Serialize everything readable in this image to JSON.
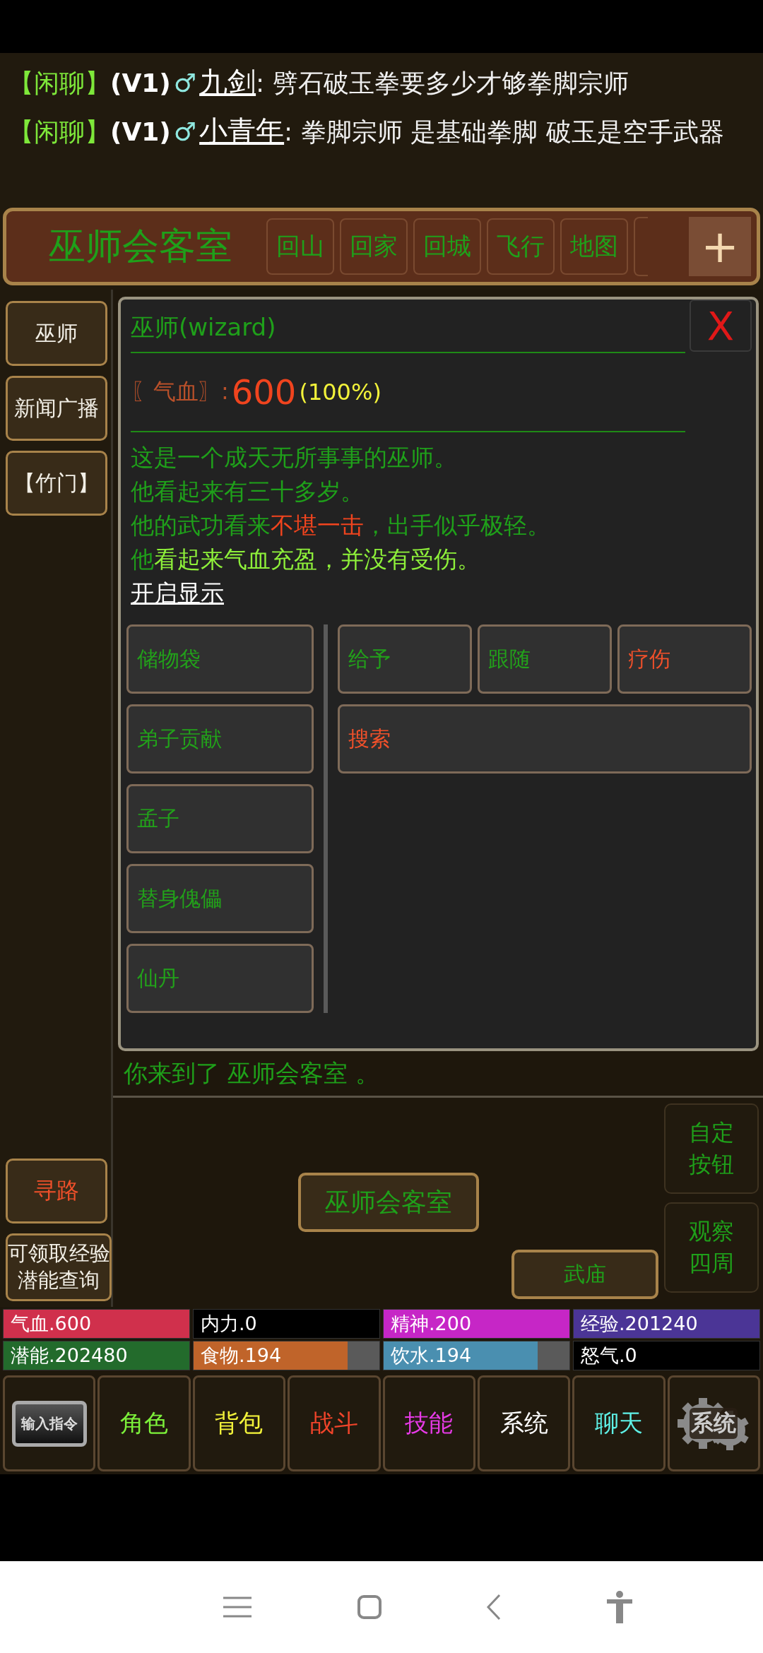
{
  "chat": [
    {
      "channel": "【闲聊】",
      "vip": "(V1)",
      "gender": "♂",
      "name": "九剑",
      "message": ": 劈石破玉拳要多少才够拳脚宗师"
    },
    {
      "channel": "【闲聊】",
      "vip": "(V1)",
      "gender": "♂",
      "name": "小青年",
      "message": ": 拳脚宗师  是基础拳脚  破玉是空手武器"
    }
  ],
  "location_bar": {
    "title": "巫师会客室",
    "shortcuts": [
      "回山",
      "回家",
      "回城",
      "飞行",
      "地图"
    ],
    "add_button": "+"
  },
  "sidebar": {
    "top": [
      "巫师",
      "新闻广播",
      "【竹门】"
    ],
    "bottom": [
      "寻路"
    ],
    "bonus_lines": [
      "可领取经验",
      "潜能查询"
    ]
  },
  "npc_panel": {
    "title": "巫师(wizard)",
    "close": "X",
    "hp_label": "〖气血〗:",
    "hp_value": "600",
    "hp_percent": "(100%)",
    "description": [
      {
        "segments": [
          {
            "text": "这是一个成天无所事事的巫师。",
            "kind": "normal"
          }
        ]
      },
      {
        "segments": [
          {
            "text": "他看起来有三十多岁。",
            "kind": "normal"
          }
        ]
      },
      {
        "segments": [
          {
            "text": "他的武功看来",
            "kind": "normal"
          },
          {
            "text": "不堪一击",
            "kind": "danger"
          },
          {
            "text": "，出手似乎极轻。",
            "kind": "normal"
          }
        ]
      },
      {
        "segments": [
          {
            "text": "他",
            "kind": "normal"
          },
          {
            "text": "看起来气血充盈，并没有受伤。",
            "kind": "bright"
          }
        ]
      }
    ],
    "toggle_link": "开启显示",
    "items": [
      "储物袋",
      "弟子贡献",
      "孟子",
      "替身傀儡",
      "仙丹"
    ],
    "action_rows": [
      [
        {
          "label": "给予",
          "kind": "normal"
        },
        {
          "label": "跟随",
          "kind": "normal"
        },
        {
          "label": "疗伤",
          "kind": "danger"
        }
      ],
      [
        {
          "label": "搜索",
          "kind": "danger"
        }
      ]
    ]
  },
  "arrival": "你来到了 巫师会客室 。",
  "map": {
    "current": "巫师会客室",
    "exits": [
      "武庙"
    ],
    "side_buttons": [
      [
        "自定",
        "按钮"
      ],
      [
        "观察",
        "四周"
      ]
    ]
  },
  "stats": [
    {
      "label": "气血.600",
      "color": "#d0304c",
      "level": 1
    },
    {
      "label": "内力.0",
      "color": "#000000",
      "level": 1
    },
    {
      "label": "精神.200",
      "color": "#c626c6",
      "level": 1
    },
    {
      "label": "经验.201240",
      "color": "#4b3596",
      "level": 1
    },
    {
      "label": "潜能.202480",
      "color": "#236b2c",
      "level": 1
    },
    {
      "label": "食物.194",
      "color": "#c0642a",
      "level": 0.83
    },
    {
      "label": "饮水.194",
      "color": "#4a8fb0",
      "level": 0.83
    },
    {
      "label": "怒气.0",
      "color": "#000000",
      "level": 1
    }
  ],
  "nav": [
    {
      "kind": "image",
      "label": "输入指令"
    },
    {
      "kind": "text",
      "label": "角色",
      "color": "#7cf03a"
    },
    {
      "kind": "text",
      "label": "背包",
      "color": "#f2f23a"
    },
    {
      "kind": "text",
      "label": "战斗",
      "color": "#f0442a"
    },
    {
      "kind": "text",
      "label": "技能",
      "color": "#e63ae6"
    },
    {
      "kind": "text",
      "label": "系统",
      "color": "#ffffff"
    },
    {
      "kind": "text",
      "label": "聊天",
      "color": "#5ef0e6"
    },
    {
      "kind": "gear",
      "label": "系统"
    }
  ]
}
